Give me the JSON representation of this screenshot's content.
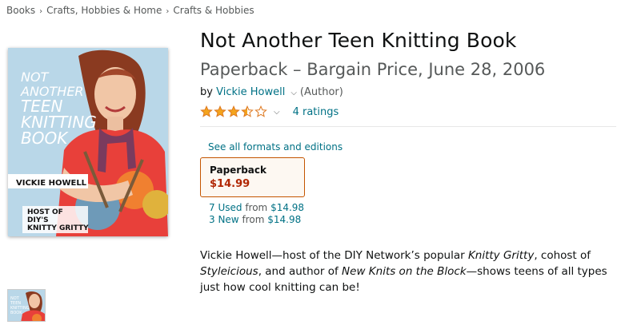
{
  "breadcrumb": [
    "Books",
    "Crafts, Hobbies & Home",
    "Crafts & Hobbies"
  ],
  "product": {
    "title": "Not Another Teen Knitting Book",
    "subtitle": "Paperback – Bargain Price, June 28, 2006",
    "by_prefix": "by",
    "author": "Vickie Howell",
    "author_role": "(Author)",
    "rating_stars": 3.5,
    "ratings_count": "4 ratings"
  },
  "cover": {
    "title_lines": [
      "NOT",
      "ANOTHER",
      "TEEN",
      "KNITTING",
      "BOOK"
    ],
    "author_name": "VICKIE HOWELL",
    "host_lines": [
      "HOST OF",
      "DIY'S",
      "KNITTY GRITTY"
    ],
    "bg_color": "#b9d7e8",
    "sweater_color": "#e8403a"
  },
  "formats": {
    "see_all_label": "See all formats and editions",
    "selected": {
      "format": "Paperback",
      "price": "$14.99"
    },
    "offers": [
      {
        "label": "7 Used",
        "from_label": "from",
        "price": "$14.98"
      },
      {
        "label": "3 New",
        "from_label": "from",
        "price": "$14.98"
      }
    ]
  },
  "description": {
    "segments": [
      {
        "text": "Vickie Howell—host of the DIY Network’s popular ",
        "italic": false
      },
      {
        "text": "Knitty Gritty",
        "italic": true
      },
      {
        "text": ", cohost of ",
        "italic": false
      },
      {
        "text": "Styleicious",
        "italic": true
      },
      {
        "text": ", and author of ",
        "italic": false
      },
      {
        "text": "New Knits on the Block",
        "italic": true
      },
      {
        "text": "—shows teens of all types just how cool knitting can be!",
        "italic": false
      }
    ]
  },
  "colors": {
    "link": "#007185",
    "price": "#b12704",
    "star": "#f4a41c",
    "selected_border": "#c45500"
  }
}
